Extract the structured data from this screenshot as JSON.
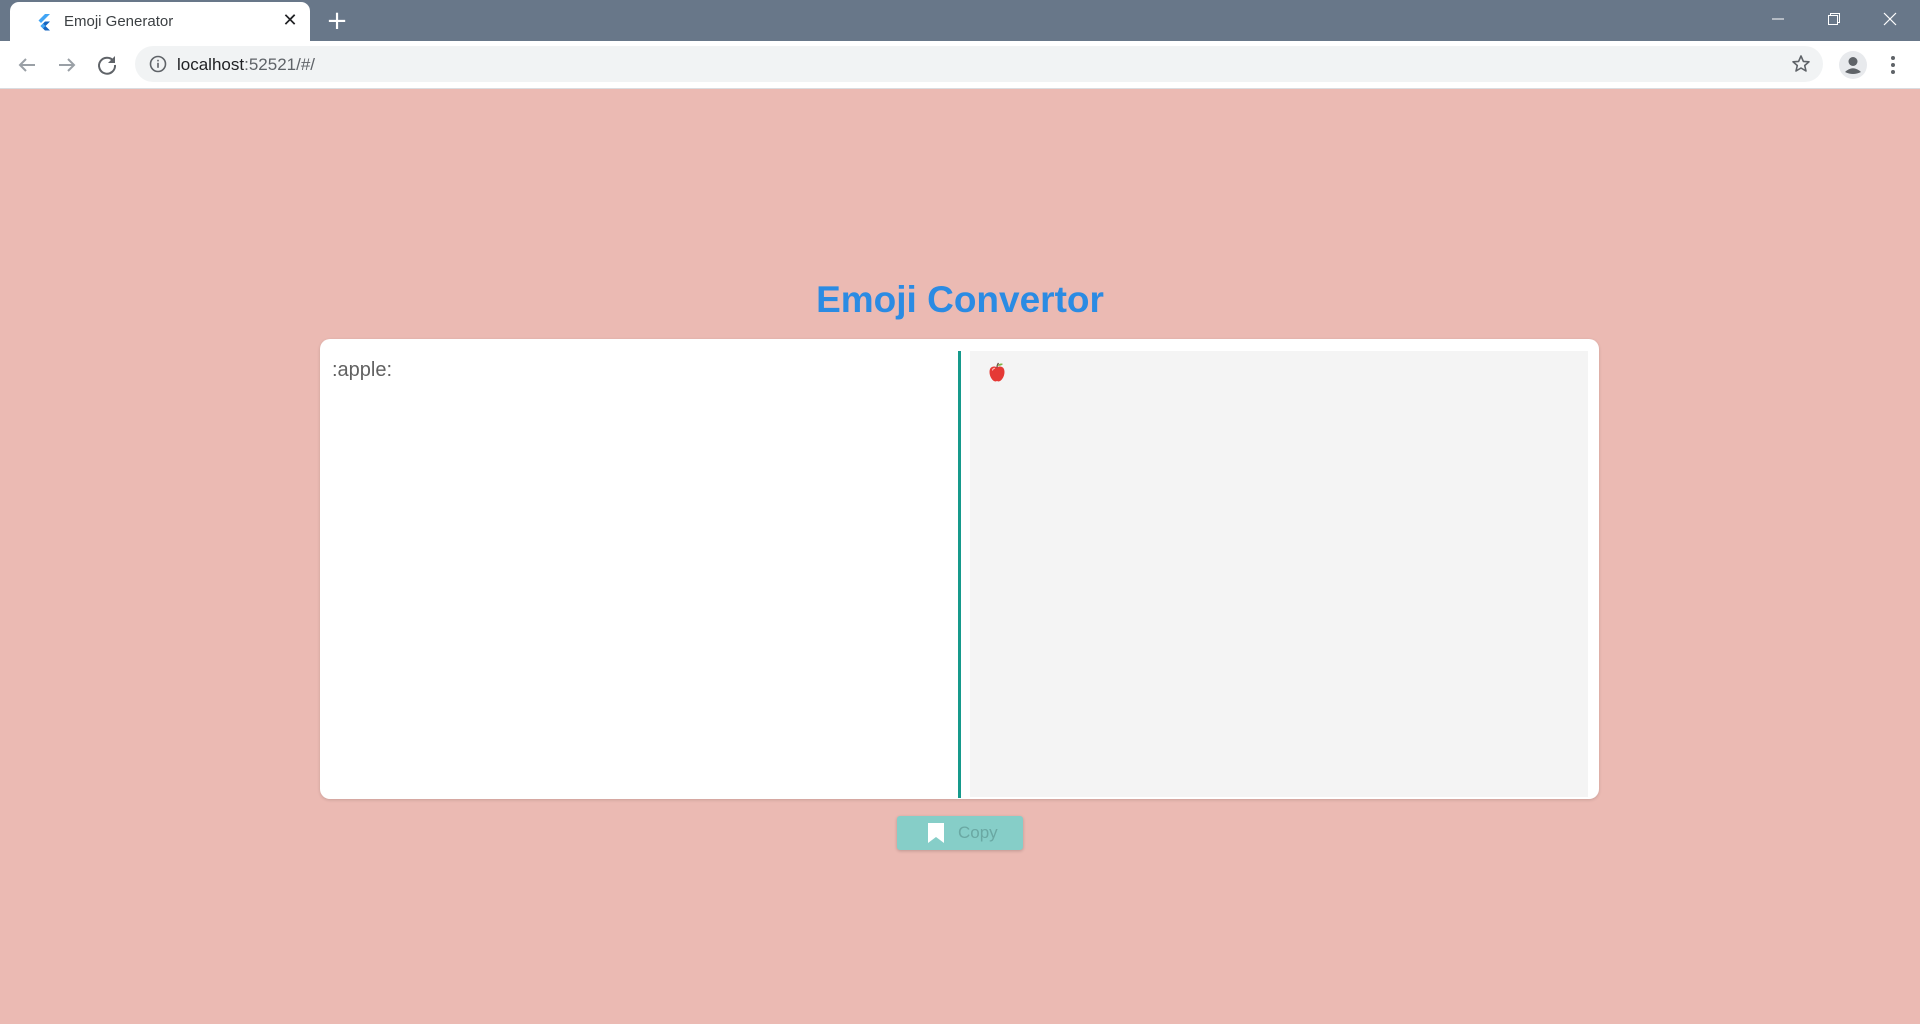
{
  "browser": {
    "tab_title": "Emoji Generator",
    "tab_close_glyph": "✕",
    "new_tab_glyph": "+",
    "window_controls": {
      "minimize": "—",
      "maximize": "❐",
      "close": "✕"
    },
    "url_host": "localhost",
    "url_rest": ":52521/#/"
  },
  "icons": {
    "favicon": "flutter-logo-icon",
    "back": "arrow-left-icon",
    "forward": "arrow-right-icon",
    "reload": "reload-icon",
    "site_info": "info-icon",
    "bookmark": "star-icon",
    "profile": "account-icon",
    "menu": "kebab-menu-icon",
    "copy": "bookmark-icon",
    "output_emoji": "apple-icon"
  },
  "page": {
    "heading": "Emoji Convertor",
    "input_text": ":apple:",
    "copy_label": "Copy"
  },
  "colors": {
    "page_background": "#ebbab3",
    "heading": "#2b8be3",
    "divider": "#169a8c",
    "copy_button": "#86cec8",
    "titlebar": "#687789"
  }
}
